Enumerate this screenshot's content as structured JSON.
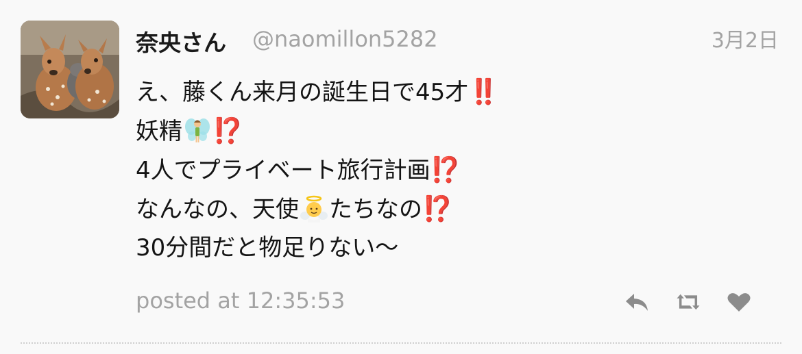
{
  "user": {
    "display_name": "奈央さん",
    "handle": "@naomillon5282"
  },
  "tweet": {
    "date": "3月2日",
    "lines": [
      {
        "text": "え、藤くん来月の誕生日で45才",
        "trail_emoji": "‼️"
      },
      {
        "text": "妖精",
        "mid_emoji": "fairy-icon",
        "trail_emoji": "⁉️"
      },
      {
        "text": "4人でプライベート旅行計画",
        "trail_emoji": "⁉️"
      },
      {
        "text_before": "なんなの、天使",
        "mid_emoji": "angel-icon",
        "text_after": "たちなの",
        "trail_emoji": "⁉️"
      },
      {
        "text": "30分間だと物足りない〜"
      }
    ],
    "posted_at": "posted at 12:35:53"
  },
  "actions": [
    {
      "name": "reply-icon"
    },
    {
      "name": "retweet-icon"
    },
    {
      "name": "heart-icon"
    }
  ],
  "colors": {
    "background": "#f9f9f9",
    "muted_text": "#a3a3a3",
    "emoji_red": "#e0241b"
  }
}
